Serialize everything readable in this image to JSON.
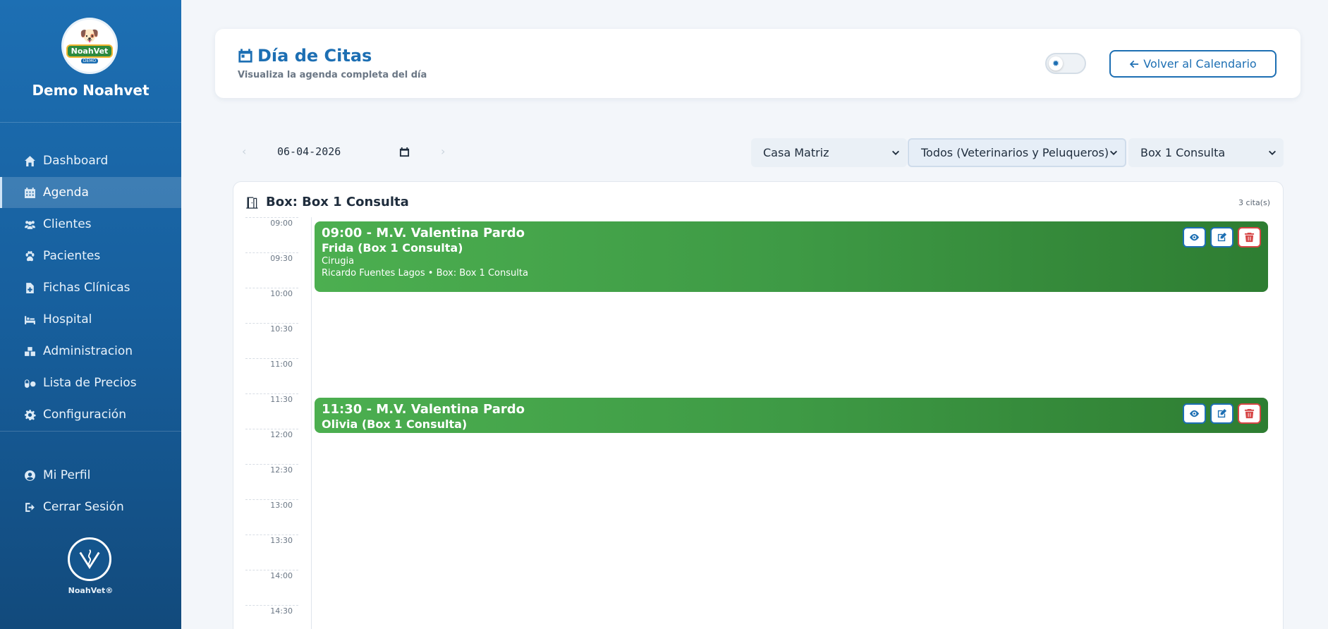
{
  "sidebar": {
    "logo_text": "NoahVet",
    "logo_demo": "DEMO",
    "brand": "Demo Noahvet",
    "items": [
      {
        "label": "Dashboard",
        "icon": "home-icon"
      },
      {
        "label": "Agenda",
        "icon": "calendar-icon",
        "active": true
      },
      {
        "label": "Clientes",
        "icon": "users-icon"
      },
      {
        "label": "Pacientes",
        "icon": "paw-icon"
      },
      {
        "label": "Fichas Clínicas",
        "icon": "file-medical-icon"
      },
      {
        "label": "Hospital",
        "icon": "hospital-bed-icon"
      },
      {
        "label": "Administracion",
        "icon": "boxes-icon"
      },
      {
        "label": "Lista de Precios",
        "icon": "pills-icon"
      },
      {
        "label": "Configuración",
        "icon": "gear-icon"
      }
    ],
    "profile": {
      "label": "Mi Perfil",
      "icon": "user-circle-icon"
    },
    "logout": {
      "label": "Cerrar Sesión",
      "icon": "logout-icon"
    },
    "footer_brand": "NoahVet®"
  },
  "header": {
    "title": "Día de Citas",
    "subtitle": "Visualiza la agenda completa del día",
    "back_button": "Volver al Calendario"
  },
  "filters": {
    "date": "06-04-2026",
    "branch": "Casa Matriz",
    "staff": "Todos (Veterinarios y Peluqueros)",
    "box": "Box 1 Consulta"
  },
  "box_panel": {
    "title": "Box: Box 1 Consulta",
    "count": "3 cita(s)",
    "times": [
      "09:00",
      "09:30",
      "10:00",
      "10:30",
      "11:00",
      "11:30",
      "12:00",
      "12:30",
      "13:00",
      "13:30",
      "14:00",
      "14:30"
    ]
  },
  "appointments": [
    {
      "title": "09:00 - M.V. Valentina Pardo",
      "pet": "Frida (Box 1 Consulta)",
      "type": "Cirugia",
      "detail": "Ricardo Fuentes Lagos • Box: Box 1 Consulta"
    },
    {
      "title": "11:30 - M.V. Valentina Pardo",
      "pet": "Olivia (Box 1 Consulta)"
    }
  ],
  "colors": {
    "primary": "#1d6fb3",
    "appointment": "#4caf50",
    "danger": "#d64545"
  }
}
